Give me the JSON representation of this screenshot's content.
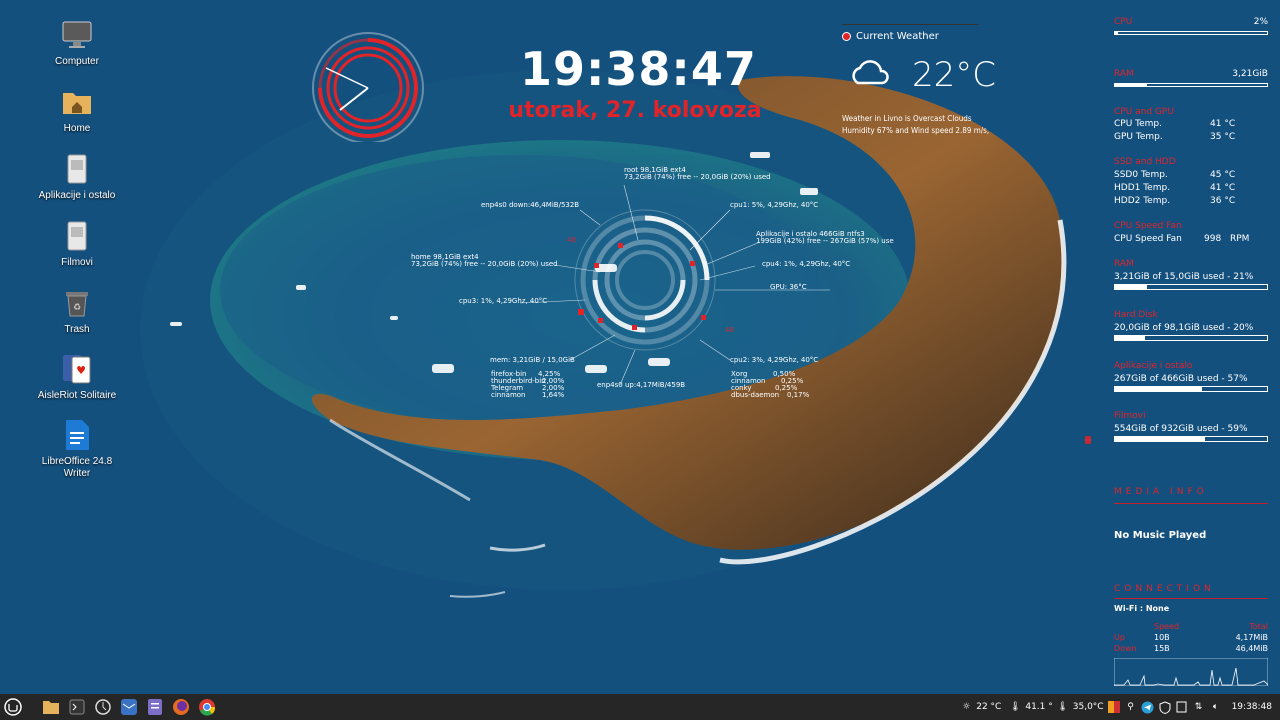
{
  "desktop": {
    "icons": [
      {
        "label": "Computer"
      },
      {
        "label": "Home"
      },
      {
        "label": "Aplikacije i ostalo"
      },
      {
        "label": "Filmovi"
      },
      {
        "label": "Trash"
      },
      {
        "label": "AisleRiot Solitaire"
      },
      {
        "label": "LibreOffice 24.8 Writer"
      }
    ]
  },
  "clock": {
    "time": "19:38:47",
    "date": "utorak, 27. kolovoza"
  },
  "weather": {
    "title": "Current Weather",
    "temperature": "22°C",
    "description_line1": "Weather in Livno is Overcast Clouds",
    "description_line2": "Humidity 67% and Wind speed 2.89 m/s,",
    "icon": "cloud-icon"
  },
  "conky": {
    "root": "root 98,1GiB ext4",
    "root_usage": "73,2GiB (74%) free -- 20,0GiB (20%) used",
    "net_down": "enp4s0 down:46,4MiB/532B",
    "cpu1": "cpu1: 5%, 4,29Ghz, 40°C",
    "aplikacije": "Aplikacije i ostalo 466GiB ntfs3",
    "aplikacije_usage": "199GiB (42%) free -- 267GiB (57%) use",
    "home": "home 98,1GiB ext4",
    "home_usage": "73,2GiB (74%) free -- 20,0GiB (20%) used",
    "cpu4": "cpu4: 1%, 4,29Ghz, 40°C",
    "gpu": "GPU: 36°C",
    "cpu3": "cpu3: 1%, 4,29Ghz, 40°C",
    "mem": "mem: 3,21GiB / 15,0GiB",
    "cpu2": "cpu2: 3%, 4,29Ghz, 40°C",
    "net_up": "enp4s0 up:4,17MiB/459B",
    "procs_left": [
      {
        "name": "firefox-bin",
        "val": "4,25%"
      },
      {
        "name": "thunderbird-bin",
        "val": "2,00%"
      },
      {
        "name": "Telegram",
        "val": "2,00%"
      },
      {
        "name": "cinnamon",
        "val": "1,64%"
      }
    ],
    "procs_right": [
      {
        "name": "Xorg",
        "val": "0,50%"
      },
      {
        "name": "cinnamon",
        "val": "0,25%"
      },
      {
        "name": "conky",
        "val": "0,25%"
      },
      {
        "name": "dbus-daemon",
        "val": "0,17%"
      }
    ],
    "ring_labels": [
      "40",
      "40",
      "40",
      "40",
      "40"
    ]
  },
  "sysmon": {
    "cpu": {
      "title": "CPU",
      "value": "2%",
      "fraction": 0.02
    },
    "ram": {
      "title": "RAM",
      "value": "3,21GiB",
      "fraction": 0.21
    },
    "temps": {
      "title": "CPU and GPU",
      "rows": [
        {
          "label": "CPU Temp.",
          "value": "41 °C"
        },
        {
          "label": "GPU Temp.",
          "value": "35 °C"
        }
      ]
    },
    "disk_temps": {
      "title": "SSD and HDD",
      "rows": [
        {
          "label": "SSD0 Temp.",
          "value": "45 °C"
        },
        {
          "label": "HDD1 Temp.",
          "value": "41 °C"
        },
        {
          "label": "HDD2 Temp.",
          "value": "36 °C"
        }
      ]
    },
    "fan": {
      "title": "CPU Speed Fan",
      "label": "CPU Speed Fan",
      "value": "998",
      "unit": "RPM"
    },
    "ram2": {
      "title": "RAM",
      "text": "3,21GiB of 15,0GiB used - 21%",
      "fraction": 0.21
    },
    "hdd": {
      "title": "Hard Disk",
      "text": "20,0GiB of 98,1GiB used - 20%",
      "fraction": 0.2
    },
    "apl": {
      "title": "Aplikacije i ostalo",
      "text": "267GiB of 466GiB used - 57%",
      "fraction": 0.57
    },
    "film": {
      "title": "Filmovi",
      "text": "554GiB of 932GiB used - 59%",
      "fraction": 0.59
    },
    "media": {
      "heading": "MEDIA INFO",
      "text": "No Music Played"
    },
    "connection": {
      "heading": "CONNECTION",
      "wifi": "Wi-Fi : None",
      "col_speed": "Speed",
      "col_total": "Total",
      "up_label": "Up",
      "down_label": "Down",
      "up_speed": "10B",
      "up_total": "4,17MiB",
      "down_speed": "15B",
      "down_total": "46,4MiB"
    }
  },
  "taskbar": {
    "apps": [
      "menu-icon",
      "files-icon",
      "terminal-icon",
      "timeshift-icon",
      "mail-icon",
      "text-editor-icon",
      "firefox-icon",
      "chrome-icon"
    ],
    "tray": {
      "weather_temp": "22 °C",
      "cpu_temp": "41.1 °",
      "gpu_temp": "35,0°C",
      "time": "19:38:48"
    }
  },
  "colors": {
    "accent": "#e0242a",
    "taskbar": "#262626"
  }
}
